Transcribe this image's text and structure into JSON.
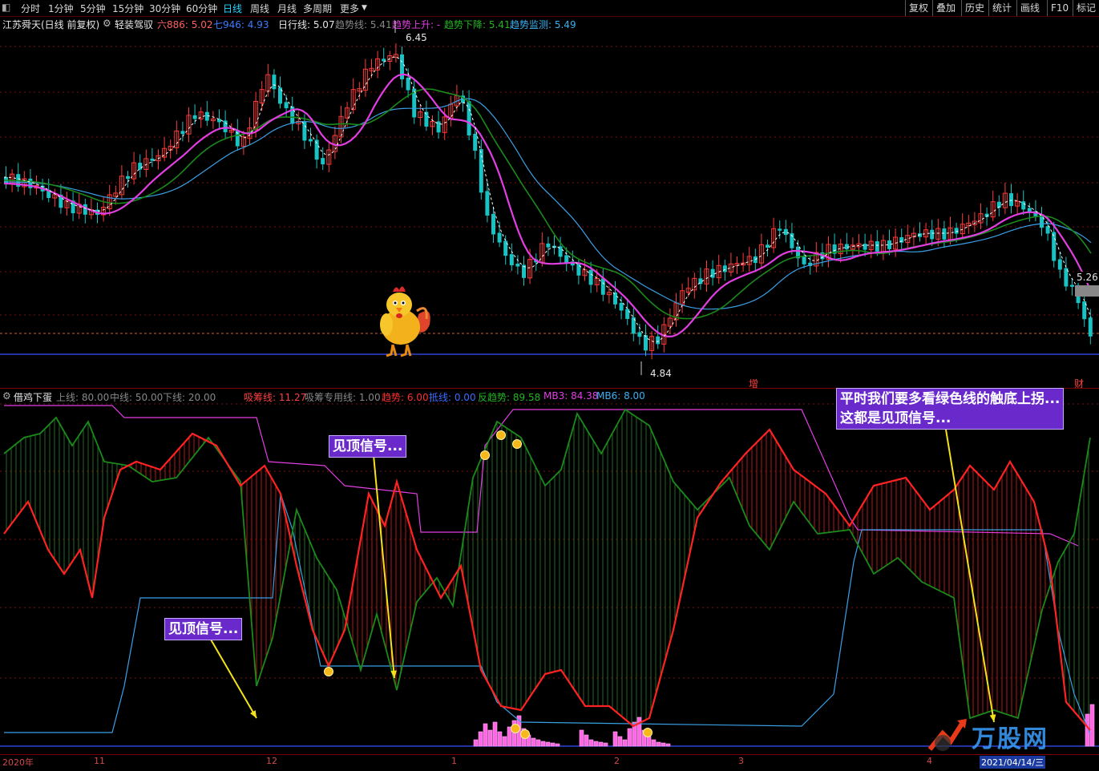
{
  "toolbar": {
    "items": [
      "分时",
      "1分钟",
      "5分钟",
      "15分钟",
      "30分钟",
      "60分钟",
      "日线",
      "周线",
      "月线",
      "多周期",
      "更多"
    ],
    "active": "日线",
    "right_buttons": [
      "复权",
      "叠加",
      "历史",
      "统计",
      "画线",
      "F10",
      "标记"
    ]
  },
  "upper": {
    "stock_title": "江苏舜天(日线 前复权)",
    "indicator_name": "轻装驾驭",
    "ma6_label": "六886: 5.02",
    "ma7_label": "七946: 4.93",
    "daily_line": "日行线: 5.07",
    "trend_line": "趋势线: 5.41",
    "trend_up": "趋势上升: -",
    "trend_down": "趋势下降: 5.41",
    "trend_monitor": "趋势监测: 5.49",
    "high_label": "6.45",
    "low_label": "4.84",
    "last_price": "5.26",
    "mark_zeng": "增",
    "mark_cai": "财"
  },
  "lower": {
    "indicator_name": "借鸡下蛋",
    "upper_line": "上线: 80.00",
    "mid_line": "中线: 50.00",
    "lower_line": "下线: 20.00",
    "xichou": "吸筹线: 11.27",
    "xichou_special": "吸筹专用线: 1.00",
    "trend": "趋势: 6.00",
    "dixian": "抵线: 0.00",
    "fanqushi": "反趋势: 89.58",
    "mb3": "MB3: 84.38",
    "mb6": "MB6: 8.00"
  },
  "callouts": {
    "signal_top_1": "见顶信号...",
    "signal_top_2": "见顶信号...",
    "note_line1": "平时我们要多看绿色线的触底上拐...",
    "note_line2": "这都是见顶信号..."
  },
  "dates": {
    "d0": "2020年",
    "d1": "11",
    "d2": "12",
    "d3": "1",
    "d4": "2",
    "d5": "3",
    "d6": "4",
    "footer_date": "2021/04/14/三"
  },
  "watermark": "万股网",
  "colors": {
    "up": "#ff3b3b",
    "down": "#19c3c3",
    "magenta": "#e23ee2",
    "green": "#1a8a1a",
    "blue": "#3aa0e6",
    "red_line": "#ff2222",
    "callout_bg": "#6a2acb"
  }
}
